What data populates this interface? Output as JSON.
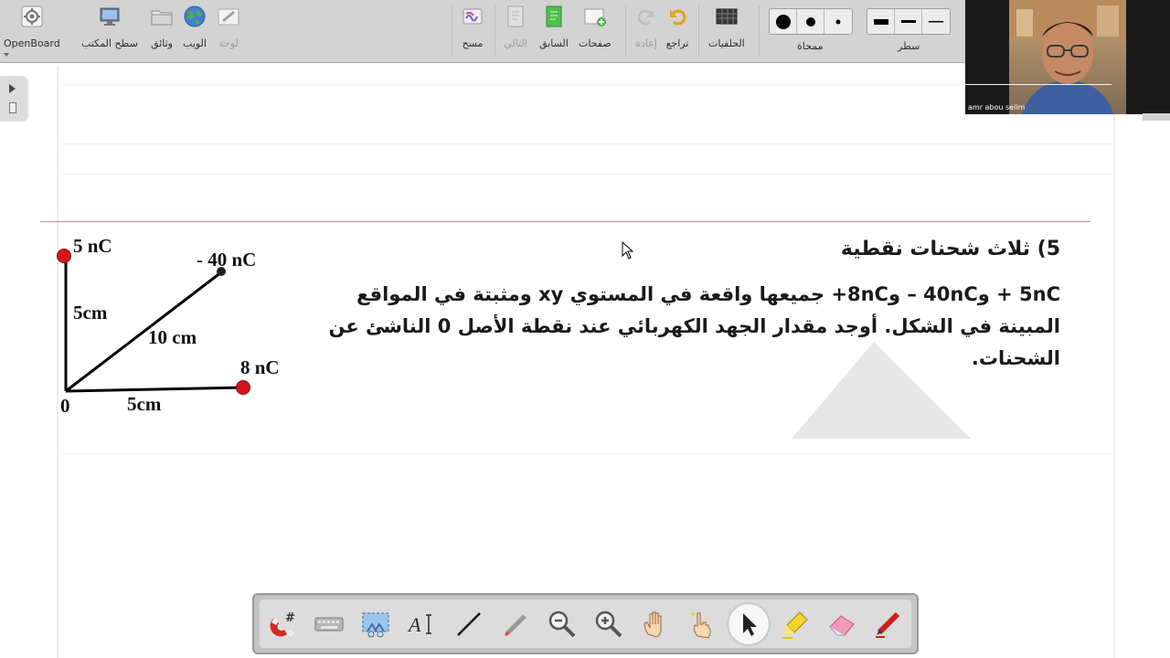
{
  "toolbar": {
    "openboard": "OpenBoard",
    "desktop": "سطح المكتب",
    "documents": "وثائق",
    "web": "الويب",
    "board": "لوحة",
    "erase": "مسح",
    "next": "التالي",
    "previous": "السابق",
    "pages": "صفحات",
    "redo": "إعادة",
    "undo": "تراجع",
    "backgrounds": "الحلفيات",
    "eraser_size": "ممحاة",
    "line_width": "سطر"
  },
  "video": {
    "participant_name": "amr abou selim"
  },
  "question": {
    "number_title": "5) ثلاث شحنات نقطية",
    "line1": "5nC + و40nC – و8nC+ جميعها واقعة في المستوي xy ومثبتة في المواقع",
    "line2": "المبينة  في الشكل. أوجد   مقدار الجهد الكهربائي عند نقطة الأصل 0 الناشئ عن",
    "line3": "الشحنات."
  },
  "diagram": {
    "charge_top": "5 nC",
    "charge_diag": "- 40 nC",
    "charge_right": "8 nC",
    "dist_vertical": "5cm",
    "dist_diagonal": "10 cm",
    "dist_horizontal": "5cm",
    "origin": "0"
  },
  "colors": {
    "toolbar_bg": "#d3d3d3",
    "charge_red": "#d2151b",
    "separator_line": "#c98b8b",
    "palette_bg": "#c4c4c4"
  },
  "palette": {
    "tools": [
      "magnet-icon",
      "keyboard-icon",
      "capture-icon",
      "text-tool-icon",
      "line-tool-icon",
      "laser-pointer-icon",
      "zoom-out-icon",
      "zoom-in-icon",
      "hand-icon",
      "pointer-hand-icon",
      "select-arrow-icon",
      "highlighter-icon",
      "eraser-icon",
      "pen-icon"
    ],
    "active": "select-arrow-icon"
  }
}
